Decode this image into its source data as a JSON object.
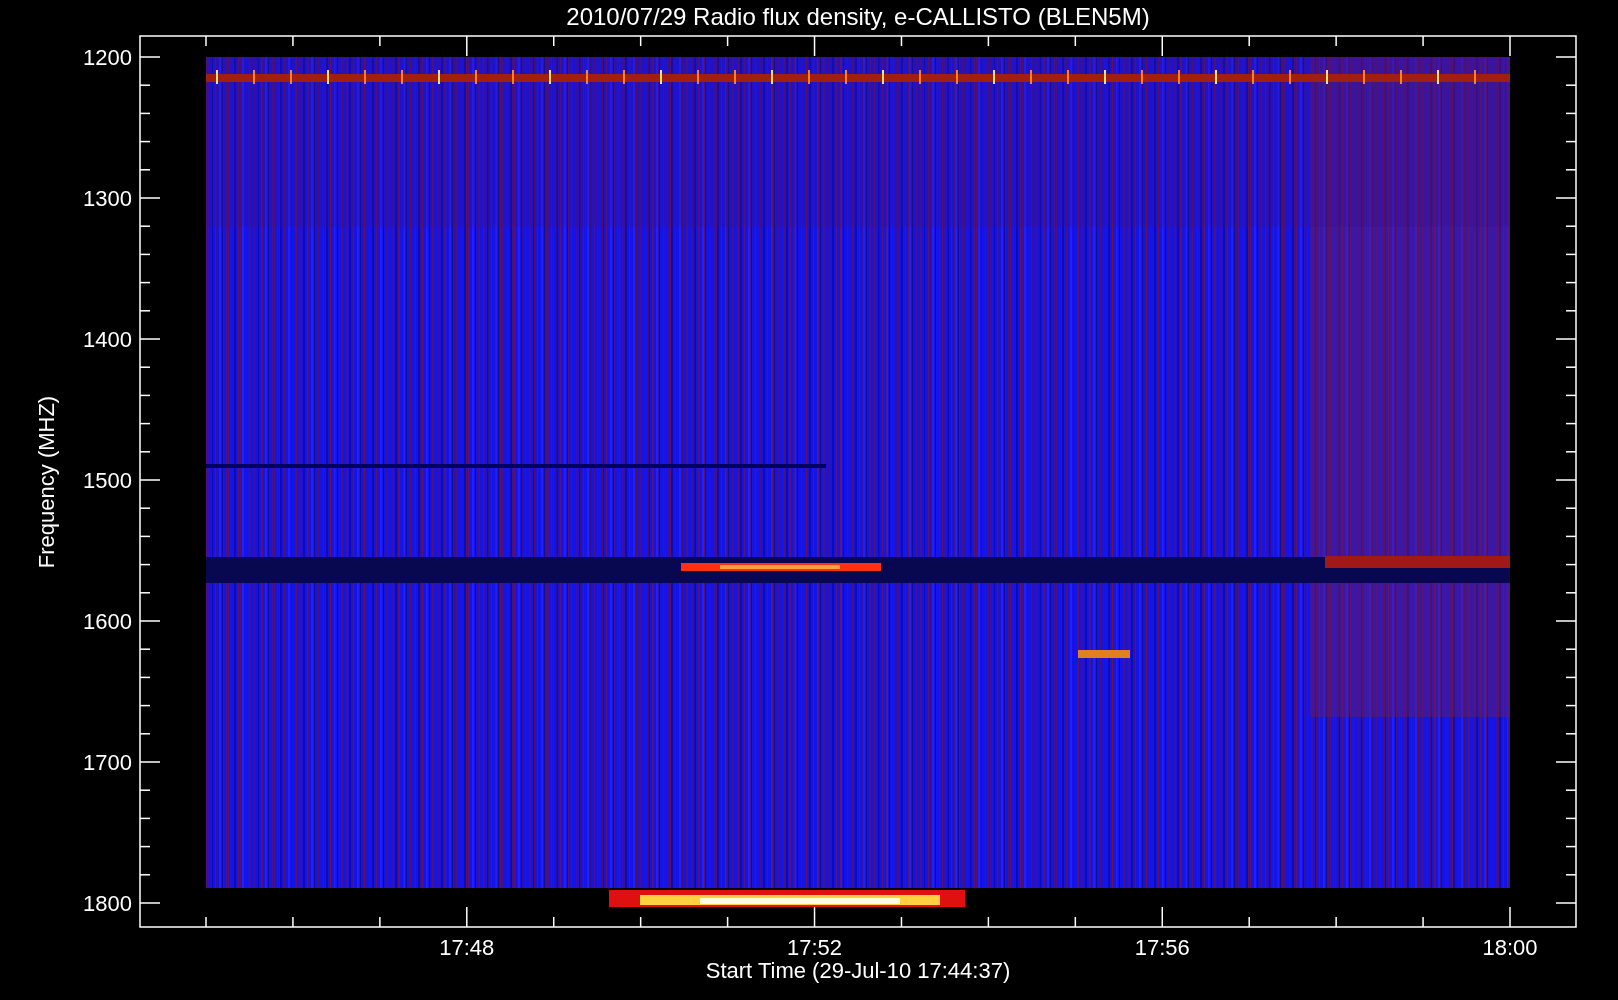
{
  "title": "2010/07/29  Radio flux density, e-CALLISTO (BLEN5M)",
  "y_axis": {
    "label": "Frequency (MHZ)",
    "tick_labels": [
      "1200",
      "1300",
      "1400",
      "1500",
      "1600",
      "1700",
      "1800"
    ]
  },
  "x_axis": {
    "label": "Start Time (29-Jul-10 17:44:37)",
    "tick_labels": [
      "17:48",
      "17:52",
      "17:56",
      "18:00"
    ]
  }
}
